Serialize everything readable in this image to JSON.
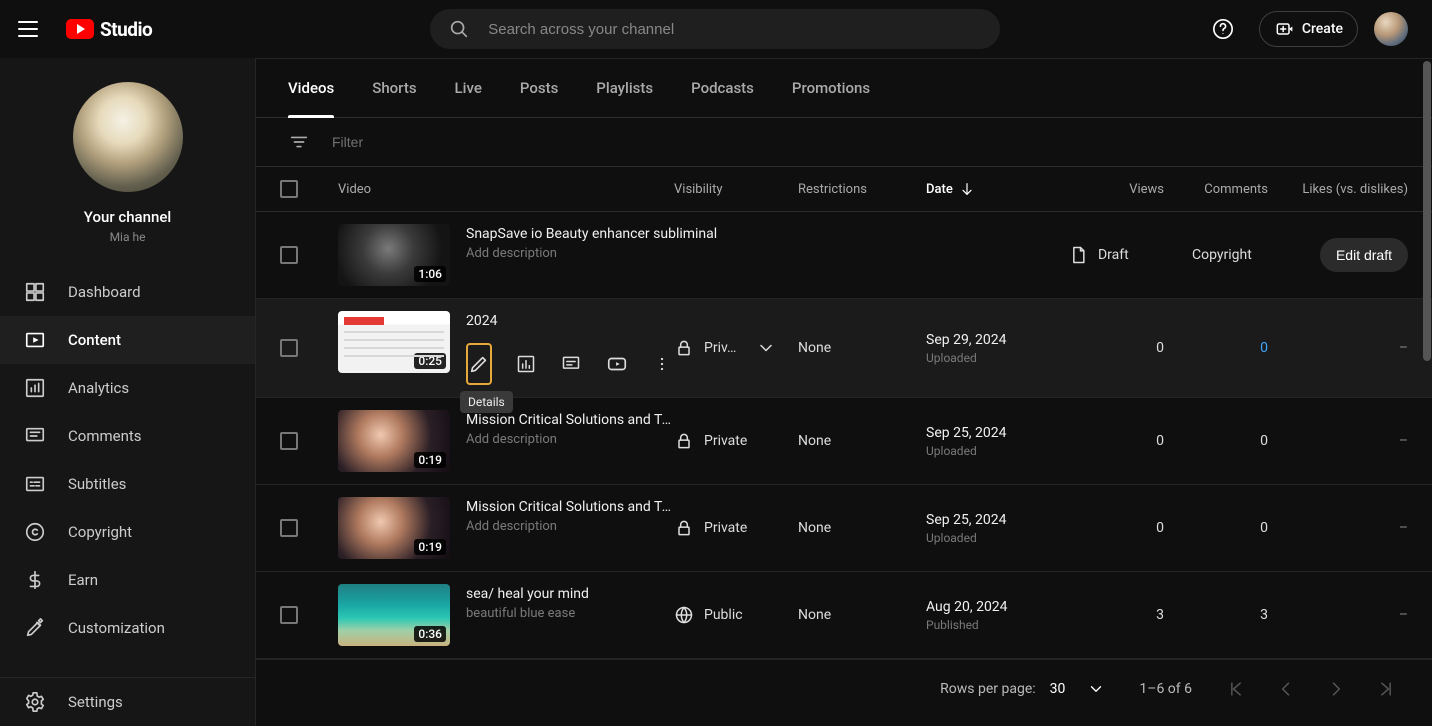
{
  "header": {
    "logo_text": "Studio",
    "search_placeholder": "Search across your channel",
    "create_label": "Create"
  },
  "sidebar": {
    "channel_header": "Your channel",
    "channel_name": "Mia he",
    "items": [
      {
        "id": "dashboard",
        "label": "Dashboard"
      },
      {
        "id": "content",
        "label": "Content"
      },
      {
        "id": "analytics",
        "label": "Analytics"
      },
      {
        "id": "comments",
        "label": "Comments"
      },
      {
        "id": "subtitles",
        "label": "Subtitles"
      },
      {
        "id": "copyright",
        "label": "Copyright"
      },
      {
        "id": "earn",
        "label": "Earn"
      },
      {
        "id": "customization",
        "label": "Customization"
      }
    ],
    "footer_item": {
      "id": "settings",
      "label": "Settings"
    }
  },
  "tabs": [
    {
      "id": "videos",
      "label": "Videos",
      "active": true
    },
    {
      "id": "shorts",
      "label": "Shorts"
    },
    {
      "id": "live",
      "label": "Live"
    },
    {
      "id": "posts",
      "label": "Posts"
    },
    {
      "id": "playlists",
      "label": "Playlists"
    },
    {
      "id": "podcasts",
      "label": "Podcasts"
    },
    {
      "id": "promotions",
      "label": "Promotions"
    }
  ],
  "filter_placeholder": "Filter",
  "columns": {
    "video": "Video",
    "visibility": "Visibility",
    "restrictions": "Restrictions",
    "date": "Date",
    "views": "Views",
    "comments": "Comments",
    "likes": "Likes (vs. dislikes)"
  },
  "hover_tooltip": "Details",
  "edit_draft_label": "Edit draft",
  "rows": [
    {
      "title": "SnapSave io Beauty enhancer subliminal",
      "desc": "Add description",
      "duration": "1:06",
      "visibility": "Draft",
      "vis_icon": "draft",
      "restrictions": "Copyright",
      "date": "",
      "date_sub": "",
      "views": "",
      "comments": "",
      "likes": "",
      "edit_draft": true,
      "thumb": "bw"
    },
    {
      "title": "2024",
      "desc": "",
      "duration": "0:25",
      "visibility": "Priv…",
      "vis_icon": "private",
      "vis_chevron": true,
      "restrictions": "None",
      "date": "Sep 29, 2024",
      "date_sub": "Uploaded",
      "views": "0",
      "comments": "0",
      "comments_link": true,
      "likes": "–",
      "hover": true,
      "thumb": "doc"
    },
    {
      "title": "Mission Critical Solutions and TestRail",
      "desc": "Add description",
      "duration": "0:19",
      "visibility": "Private",
      "vis_icon": "private",
      "restrictions": "None",
      "date": "Sep 25, 2024",
      "date_sub": "Uploaded",
      "views": "0",
      "comments": "0",
      "likes": "–",
      "thumb": "man"
    },
    {
      "title": "Mission Critical Solutions and TestRail",
      "desc": "Add description",
      "duration": "0:19",
      "visibility": "Private",
      "vis_icon": "private",
      "restrictions": "None",
      "date": "Sep 25, 2024",
      "date_sub": "Uploaded",
      "views": "0",
      "comments": "0",
      "likes": "–",
      "thumb": "man"
    },
    {
      "title": "sea/ heal your mind",
      "desc": "beautiful blue ease",
      "duration": "0:36",
      "visibility": "Public",
      "vis_icon": "public",
      "restrictions": "None",
      "date": "Aug 20, 2024",
      "date_sub": "Published",
      "views": "3",
      "comments": "3",
      "likes": "–",
      "thumb": "sea"
    }
  ],
  "footer": {
    "rpp_label": "Rows per page:",
    "rpp_value": "30",
    "range": "1–6 of 6"
  }
}
